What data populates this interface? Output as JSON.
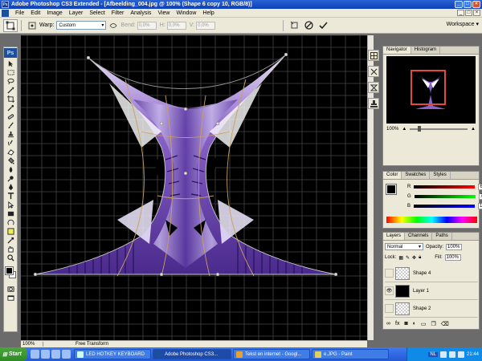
{
  "window": {
    "title": "Adobe Photoshop CS3 Extended - [Afbeelding_004.jpg @ 100% (Shape 6 copy 10, RGB/8)]",
    "controls": [
      "_",
      "□",
      "×"
    ]
  },
  "menu": {
    "items": [
      "File",
      "Edit",
      "Image",
      "Layer",
      "Select",
      "Filter",
      "Analysis",
      "View",
      "Window",
      "Help"
    ]
  },
  "options": {
    "warp_label": "Warp:",
    "warp_value": "Custom",
    "bend_label": "Bend:",
    "bend_value": "0,0",
    "h_label": "H:",
    "h_value": "0,0",
    "v_label": "V:",
    "v_value": "0,0",
    "unit": "%",
    "workspace_label": "Workspace"
  },
  "navigator": {
    "tabs": [
      "Navigator",
      "Histogram"
    ],
    "zoom": "100%"
  },
  "color_panel": {
    "tabs": [
      "Color",
      "Swatches",
      "Styles"
    ],
    "channels": [
      {
        "label": "R",
        "value": "6",
        "color": "#e02020"
      },
      {
        "label": "G",
        "value": "7",
        "color": "#20c020"
      },
      {
        "label": "B",
        "value": "10",
        "color": "#2020e0"
      }
    ]
  },
  "layers_panel": {
    "tabs": [
      "Layers",
      "Channels",
      "Paths"
    ],
    "blend_mode": "Normal",
    "opacity_label": "Opacity:",
    "opacity_value": "100%",
    "lock_label": "Lock:",
    "fill_label": "Fill:",
    "fill_value": "100%",
    "layers": [
      {
        "name": "Shape 4",
        "thumb": "checker",
        "visible": false
      },
      {
        "name": "Layer 1",
        "thumb": "black",
        "visible": true
      },
      {
        "name": "Shape 2",
        "thumb": "checker",
        "visible": false
      }
    ]
  },
  "status": {
    "zoom": "100%",
    "info": "Free Transform"
  },
  "taskbar": {
    "start_label": "Start",
    "tasks": [
      {
        "label": "LED HOTKEY KEYBOARD",
        "active": false
      },
      {
        "label": "Adobe Photoshop CS3...",
        "active": true
      },
      {
        "label": "Tekst en internet - Googl...",
        "active": false
      },
      {
        "label": "e.JPG - Paint",
        "active": false
      }
    ],
    "language": "NL",
    "clock": "21:44"
  },
  "colors": {
    "accent_blue": "#0a3fb8",
    "artwork_purple": "#7a4ec0",
    "warp_line": "#c8a060"
  }
}
